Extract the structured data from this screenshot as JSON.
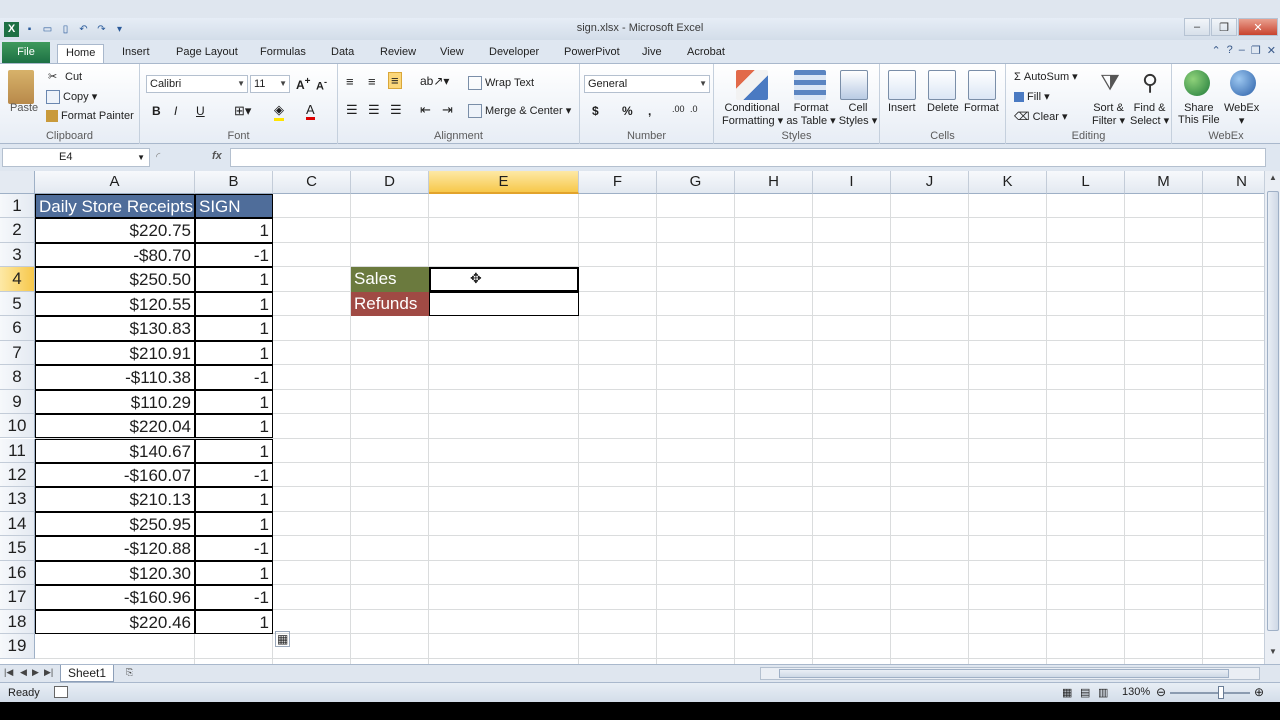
{
  "window": {
    "title": "sign.xlsx - Microsoft Excel"
  },
  "tabs": [
    "File",
    "Home",
    "Insert",
    "Page Layout",
    "Formulas",
    "Data",
    "Review",
    "View",
    "Developer",
    "PowerPivot",
    "Jive",
    "Acrobat"
  ],
  "ribbon": {
    "clipboard": {
      "paste": "Paste",
      "cut": "Cut",
      "copy": "Copy",
      "format_painter": "Format Painter",
      "label": "Clipboard"
    },
    "font": {
      "name": "Calibri",
      "size": "11",
      "label": "Font",
      "bold": "B",
      "italic": "I",
      "underline": "U"
    },
    "alignment": {
      "wrap": "Wrap Text",
      "merge": "Merge & Center",
      "label": "Alignment"
    },
    "number": {
      "format": "General",
      "currency": "$",
      "percent": "%",
      "comma": ",",
      "label": "Number"
    },
    "styles": {
      "conditional": "Conditional",
      "conditional2": "Formatting",
      "format_table": "Format",
      "format_table2": "as Table",
      "cell_styles": "Cell",
      "cell_styles2": "Styles",
      "label": "Styles"
    },
    "cells": {
      "insert": "Insert",
      "delete": "Delete",
      "format": "Format",
      "label": "Cells"
    },
    "editing": {
      "autosum": "AutoSum",
      "fill": "Fill",
      "clear": "Clear",
      "sort": "Sort &",
      "sort2": "Filter",
      "find": "Find &",
      "find2": "Select",
      "label": "Editing"
    },
    "webex": {
      "share": "Share",
      "share2": "This File",
      "webex": "WebEx",
      "label": "WebEx"
    }
  },
  "formula_bar": {
    "name_box": "E4",
    "fx": "fx",
    "formula": ""
  },
  "columns": [
    "A",
    "B",
    "C",
    "D",
    "E",
    "F",
    "G",
    "H",
    "I",
    "J",
    "K",
    "L",
    "M",
    "N"
  ],
  "rows": [
    "1",
    "2",
    "3",
    "4",
    "5",
    "6",
    "7",
    "8",
    "9",
    "10",
    "11",
    "12",
    "13",
    "14",
    "15",
    "16",
    "17",
    "18",
    "19"
  ],
  "table": {
    "headers": [
      "Daily Store Receipts",
      "SIGN"
    ],
    "receipts": [
      "$220.75",
      "-$80.70",
      "$250.50",
      "$120.55",
      "$130.83",
      "$210.91",
      "-$110.38",
      "$110.29",
      "$220.04",
      "$140.67",
      "-$160.07",
      "$210.13",
      "$250.95",
      "-$120.88",
      "$120.30",
      "-$160.96",
      "$220.46"
    ],
    "signs": [
      "1",
      "-1",
      "1",
      "1",
      "1",
      "1",
      "-1",
      "1",
      "1",
      "1",
      "-1",
      "1",
      "1",
      "-1",
      "1",
      "-1",
      "1"
    ]
  },
  "summary": {
    "sales": "Sales",
    "refunds": "Refunds"
  },
  "sheet": {
    "name": "Sheet1"
  },
  "status": {
    "mode": "Ready",
    "zoom": "130%"
  },
  "colors": {
    "header_blue": "#4f6d9a",
    "sales_green": "#6b7a3e",
    "refunds_red": "#a04a44",
    "excel_green": "#1d7044"
  }
}
